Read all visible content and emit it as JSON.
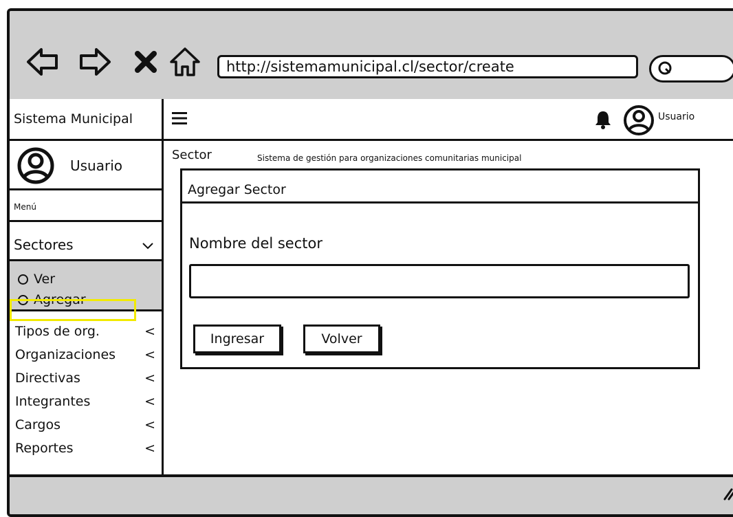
{
  "browser": {
    "url": "http://sistemamunicipal.cl/sector/create",
    "icons": [
      "back-arrow-icon",
      "forward-arrow-icon",
      "close-icon",
      "home-icon",
      "search-icon"
    ]
  },
  "header": {
    "brand": "Sistema Municipal",
    "user": "Usuario",
    "icons": [
      "hamburger-icon",
      "bell-icon",
      "user-avatar-icon"
    ]
  },
  "sidebar": {
    "user": "Usuario",
    "menu_label": "Menú",
    "section": {
      "label": "Sectores",
      "sub_items": [
        {
          "label": "Ver"
        },
        {
          "label": "Agregar"
        }
      ]
    },
    "items": [
      {
        "label": "Tipos de org."
      },
      {
        "label": "Organizaciones"
      },
      {
        "label": "Directivas"
      },
      {
        "label": "Integrantes"
      },
      {
        "label": "Cargos"
      },
      {
        "label": "Reportes"
      }
    ],
    "collapse_glyph": "<",
    "highlight_color": "#f2ea00"
  },
  "main": {
    "title": "Sector",
    "subtitle": "Sistema de gestión para organizaciones comunitarias municipal",
    "card": {
      "title": "Agregar Sector",
      "field_label": "Nombre del sector",
      "field_value": "",
      "submit_label": "Ingresar",
      "back_label": "Volver"
    }
  }
}
